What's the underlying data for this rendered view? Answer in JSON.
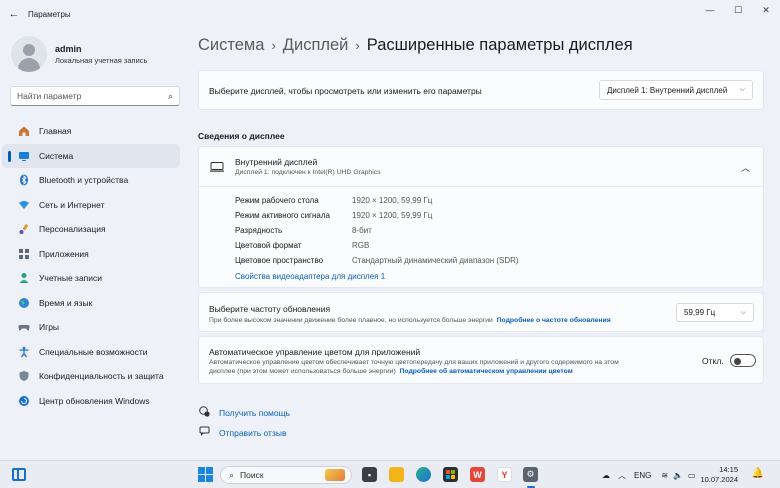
{
  "window": {
    "title": "Параметры",
    "back_label": "←",
    "controls": {
      "minimize": "—",
      "maximize": "☐",
      "close": "✕"
    }
  },
  "user": {
    "name": "admin",
    "account_type": "Локальная учетная запись"
  },
  "search": {
    "placeholder": "Найти параметр",
    "icon": "search-icon"
  },
  "nav": {
    "items": [
      {
        "label": "Главная",
        "icon": "home-icon"
      },
      {
        "label": "Система",
        "icon": "system-icon",
        "active": true
      },
      {
        "label": "Bluetooth и устройства",
        "icon": "bluetooth-icon"
      },
      {
        "label": "Сеть и Интернет",
        "icon": "network-icon"
      },
      {
        "label": "Персонализация",
        "icon": "brush-icon"
      },
      {
        "label": "Приложения",
        "icon": "apps-icon"
      },
      {
        "label": "Учетные записи",
        "icon": "accounts-icon"
      },
      {
        "label": "Время и язык",
        "icon": "globe-icon"
      },
      {
        "label": "Игры",
        "icon": "gamepad-icon"
      },
      {
        "label": "Специальные возможности",
        "icon": "accessibility-icon"
      },
      {
        "label": "Конфиденциальность и защита",
        "icon": "shield-icon"
      },
      {
        "label": "Центр обновления Windows",
        "icon": "update-icon"
      }
    ]
  },
  "breadcrumb": {
    "items": [
      "Система",
      "Дисплей"
    ],
    "current": "Расширенные параметры дисплея",
    "separator": "›"
  },
  "display_select": {
    "label": "Выберите дисплей, чтобы просмотреть или изменить его параметры",
    "value": "Дисплей 1: Внутренний дисплей"
  },
  "display_info": {
    "section_title": "Сведения о дисплее",
    "name": "Внутренний дисплей",
    "connection": "Дисплей 1: подключен к Intel(R) UHD Graphics",
    "rows": [
      {
        "key": "Режим рабочего стола",
        "value": "1920 × 1200, 59,99 Гц"
      },
      {
        "key": "Режим активного сигнала",
        "value": "1920 × 1200, 59,99 Гц"
      },
      {
        "key": "Разрядность",
        "value": "8-бит"
      },
      {
        "key": "Цветовой формат",
        "value": "RGB"
      },
      {
        "key": "Цветовое пространство",
        "value": "Стандартный динамический диапазон (SDR)"
      }
    ],
    "adapter_link": "Свойства видеоадаптера для дисплея 1"
  },
  "refresh": {
    "title": "Выберите частоту обновления",
    "desc": "При более высоком значении движение более плавное, но используется больше энергии",
    "link": "Подробнее о частоте обновления",
    "value": "59,99 Гц"
  },
  "color_mgmt": {
    "title": "Автоматическое управление цветом для приложений",
    "desc1": "Автоматическое управление цветом обеспечивает точную цветопередачу для ваших приложений и другого содержимого на этом",
    "desc2": "дисплее (при этом может использоваться больше энергии)",
    "link": "Подробнее об автоматическом управлении цветом",
    "toggle_label": "Откл.",
    "enabled": false
  },
  "help": {
    "get_help": "Получить помощь",
    "feedback": "Отправить отзыв"
  },
  "taskbar": {
    "search_label": "Поиск",
    "language": "ENG",
    "time": "14:15",
    "date": "10.07.2024"
  },
  "colors": {
    "accent": "#005fb8",
    "link": "#0a5fb5",
    "background": "#eef2f8",
    "card": "#fbfcfd"
  }
}
